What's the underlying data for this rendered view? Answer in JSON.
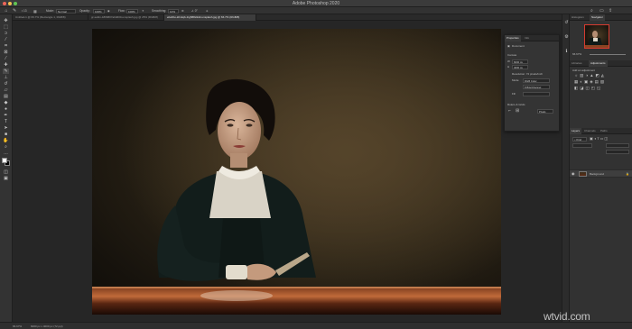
{
  "app": {
    "title": "Adobe Photoshop 2020"
  },
  "options_bar": {
    "mode_label": "Mode:",
    "mode_value": "Normal",
    "opacity_label": "Opacity:",
    "opacity_value": "100%",
    "flow_label": "Flow:",
    "flow_value": "100%",
    "smoothing_label": "Smoothing:",
    "smoothing_value": "10%"
  },
  "document_tabs": [
    {
      "label": "Untitled-1 @ 66.7% (Rectangle 1, RGB/8)"
    },
    {
      "label": "gr-sabin-1896807a0d000-unsplash.jpg @ 25% (RGB/8)"
    },
    {
      "label": "ebahho-kfmkqb-1tg588s9d2-unsplash.jpg @ 66.7% (RGB/8)"
    }
  ],
  "properties": {
    "tabs": [
      "Properties",
      "Info"
    ],
    "doc_label": "Document",
    "canvas_label": "Canvas",
    "width_value": "6000 px",
    "height_value": "4000 px",
    "resolution_label": "Resolution: 72 pixels/inch",
    "mode_label": "Mode",
    "mode_value": "RGB Color",
    "depth_value": "8 Bits/Channel",
    "fill_label": "Fill",
    "rulers_label": "Rulers & Grids",
    "units_value": "Pixels"
  },
  "right_panels": {
    "top_tabs": [
      "Histogram",
      "Navigator"
    ],
    "mid_tabs": [
      "Libraries",
      "Adjustments"
    ],
    "adjust_hint": "Add an adjustment",
    "layers_tabs": [
      "Layers",
      "Channels",
      "Paths"
    ],
    "layer_name": "Background"
  },
  "status": {
    "zoom": "66.67%",
    "doc_info": "6000 px x 4000 px (72 ppi)"
  },
  "watermark": "wtvid.com",
  "colors": {
    "fg_swatch": "#ffffff",
    "bg_swatch": "#000000",
    "accent": "#1473e6"
  },
  "icons": [
    "move-icon",
    "marquee-icon",
    "lasso-icon",
    "magic-wand-icon",
    "crop-icon",
    "eyedropper-icon",
    "healing-icon",
    "brush-icon",
    "stamp-icon",
    "history-brush-icon",
    "eraser-icon",
    "gradient-icon",
    "blur-icon",
    "dodge-icon",
    "pen-icon",
    "type-icon",
    "path-select-icon",
    "shape-icon",
    "hand-icon",
    "zoom-icon",
    "more-tools-icon"
  ]
}
